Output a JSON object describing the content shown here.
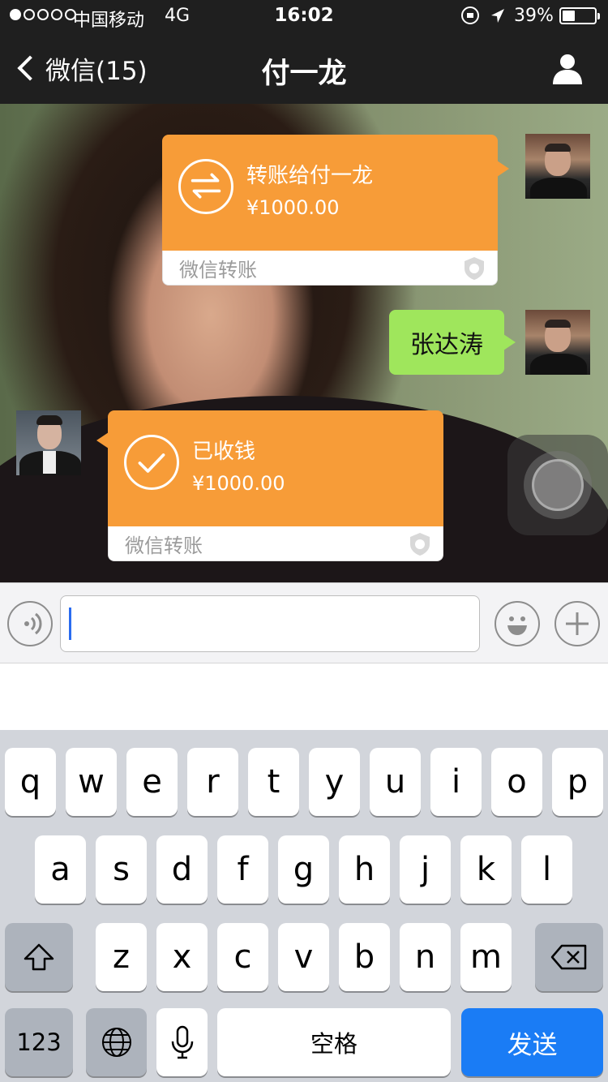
{
  "status_bar": {
    "carrier": "中国移动",
    "network": "4G",
    "time": "16:02",
    "battery": "39%"
  },
  "nav": {
    "back_label": "微信(15)",
    "title": "付一龙"
  },
  "messages": [
    {
      "type": "transfer",
      "sender": "me",
      "title": "转账给付一龙",
      "amount": "¥1000.00",
      "source": "微信转账",
      "icon": "transfer-arrows-icon"
    },
    {
      "type": "text",
      "sender": "me",
      "text": "张达涛"
    },
    {
      "type": "transfer",
      "sender": "friend",
      "title": "已收钱",
      "amount": "¥1000.00",
      "source": "微信转账",
      "icon": "checkmark-icon"
    }
  ],
  "input": {
    "value": ""
  },
  "keyboard": {
    "row1": [
      "q",
      "w",
      "e",
      "r",
      "t",
      "y",
      "u",
      "i",
      "o",
      "p"
    ],
    "row2": [
      "a",
      "s",
      "d",
      "f",
      "g",
      "h",
      "j",
      "k",
      "l"
    ],
    "row3": [
      "z",
      "x",
      "c",
      "v",
      "b",
      "n",
      "m"
    ],
    "mode_label": "123",
    "space_label": "空格",
    "send_label": "发送"
  },
  "colors": {
    "transfer_orange": "#f79c38",
    "text_bubble_green": "#9fe65c",
    "send_blue": "#1a7cf5",
    "caret_blue": "#2a6cf0"
  }
}
